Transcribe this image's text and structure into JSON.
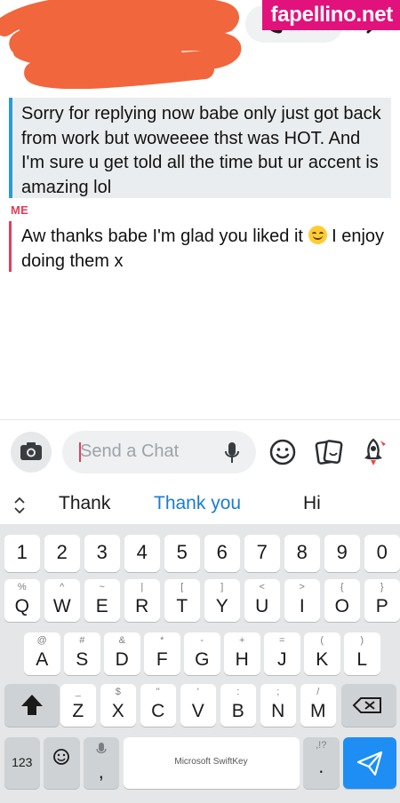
{
  "header": {
    "contact_name_redacted": "",
    "watermark": "fapellino.net",
    "icons": [
      "phone-icon",
      "video-icon",
      "more-icon"
    ]
  },
  "messages": [
    {
      "sender": "",
      "text": "Sorry for replying now babe only just got back from work but woweeee thst was HOT. And I'm sure u get told all the time but ur accent is amazing lol"
    },
    {
      "sender": "ME",
      "text_before_emoji": "Aw thanks babe I'm glad you liked it ",
      "emoji": "smiling-face-icon",
      "text_after_emoji": " I enjoy doing them x"
    }
  ],
  "chat_input": {
    "placeholder": "Send a Chat"
  },
  "suggestions": [
    "Thank",
    "Thank you",
    "Hi"
  ],
  "keyboard": {
    "numbers": [
      "1",
      "2",
      "3",
      "4",
      "5",
      "6",
      "7",
      "8",
      "9",
      "0"
    ],
    "row1": [
      {
        "k": "Q",
        "s": "%"
      },
      {
        "k": "W",
        "s": "^"
      },
      {
        "k": "E",
        "s": "~"
      },
      {
        "k": "R",
        "s": "|"
      },
      {
        "k": "T",
        "s": "["
      },
      {
        "k": "Y",
        "s": "]"
      },
      {
        "k": "U",
        "s": "<"
      },
      {
        "k": "I",
        "s": ">"
      },
      {
        "k": "O",
        "s": "{"
      },
      {
        "k": "P",
        "s": "}"
      }
    ],
    "row2": [
      {
        "k": "A",
        "s": "@"
      },
      {
        "k": "S",
        "s": "#"
      },
      {
        "k": "D",
        "s": "&"
      },
      {
        "k": "F",
        "s": "*"
      },
      {
        "k": "G",
        "s": "-"
      },
      {
        "k": "H",
        "s": "+"
      },
      {
        "k": "J",
        "s": "="
      },
      {
        "k": "K",
        "s": "("
      },
      {
        "k": "L",
        "s": ")"
      }
    ],
    "row3": [
      {
        "k": "Z",
        "s": "_"
      },
      {
        "k": "X",
        "s": "$"
      },
      {
        "k": "C",
        "s": "\""
      },
      {
        "k": "V",
        "s": "'"
      },
      {
        "k": "B",
        "s": ":"
      },
      {
        "k": "N",
        "s": ";"
      },
      {
        "k": "M",
        "s": "/"
      }
    ],
    "bottom": {
      "numbers_label": "123",
      "comma": ",",
      "space_label": "Microsoft SwiftKey",
      "period": ".",
      "period_alt": ",!?"
    }
  },
  "colors": {
    "incoming_bar": "#2a9bd8",
    "me_accent": "#e0415a",
    "watermark_bg": "#e2127c",
    "send": "#1e8ef4"
  }
}
